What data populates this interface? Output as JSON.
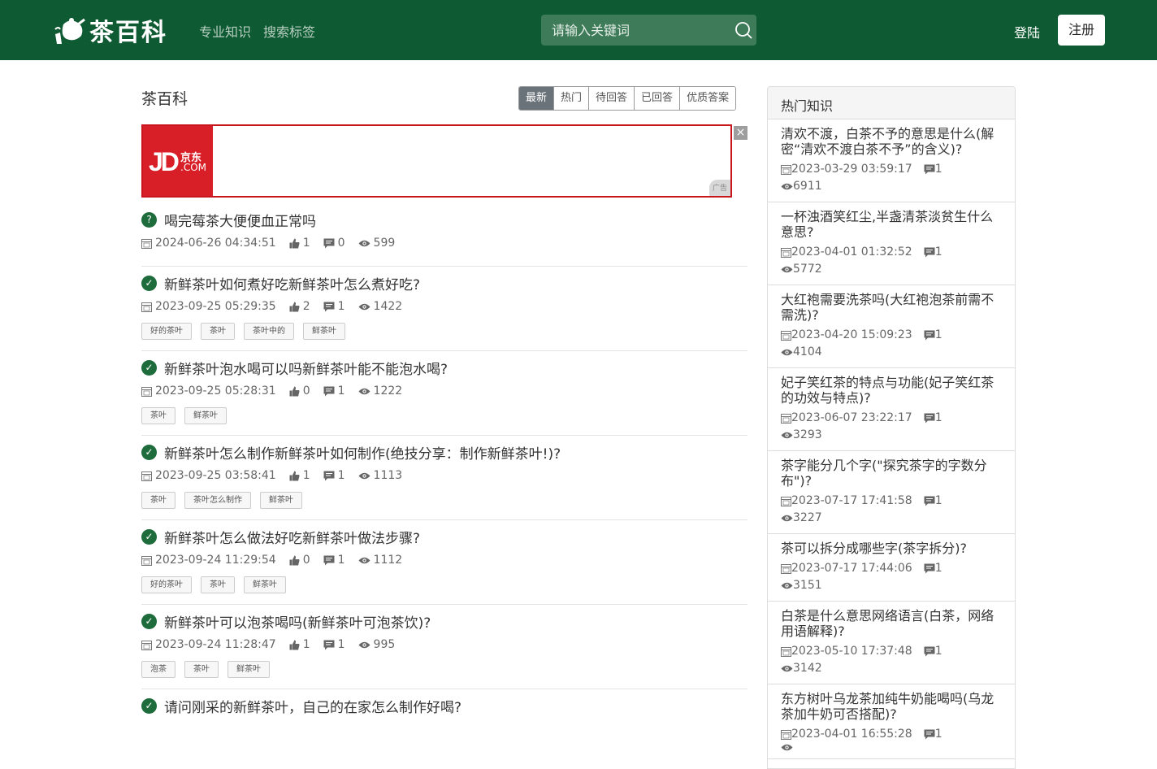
{
  "header": {
    "logo_text": "茶百科",
    "nav": [
      "专业知识",
      "搜索标签"
    ],
    "search_placeholder": "请输入关键词",
    "login": "登陆",
    "register": "注册"
  },
  "main": {
    "title": "茶百科",
    "filters": [
      "最新",
      "热门",
      "待回答",
      "已回答",
      "优质答案"
    ],
    "active_filter": "最新",
    "ad": {
      "brand_short": "JD",
      "brand_cn": "京东",
      "brand_com": ".COM",
      "tag": "广告",
      "close": "×"
    },
    "questions": [
      {
        "title": "喝完莓茶大便便血正常吗",
        "status": "unanswered",
        "status_icon": "?",
        "date": "2024-06-26 04:34:51",
        "likes": "1",
        "comments": "0",
        "views": "599",
        "tags": []
      },
      {
        "title": "新鲜茶叶如何煮好吃新鲜茶叶怎么煮好吃?",
        "status": "answered",
        "status_icon": "✓",
        "date": "2023-09-25 05:29:35",
        "likes": "2",
        "comments": "1",
        "views": "1422",
        "tags": [
          "好的茶叶",
          "茶叶",
          "茶叶中的",
          "鲜茶叶"
        ]
      },
      {
        "title": "新鲜茶叶泡水喝可以吗新鲜茶叶能不能泡水喝?",
        "status": "answered",
        "status_icon": "✓",
        "date": "2023-09-25 05:28:31",
        "likes": "0",
        "comments": "1",
        "views": "1222",
        "tags": [
          "茶叶",
          "鲜茶叶"
        ]
      },
      {
        "title": "新鲜茶叶怎么制作新鲜茶叶如何制作(绝技分享：制作新鲜茶叶!)?",
        "status": "answered",
        "status_icon": "✓",
        "date": "2023-09-25 03:58:41",
        "likes": "1",
        "comments": "1",
        "views": "1113",
        "tags": [
          "茶叶",
          "茶叶怎么制作",
          "鲜茶叶"
        ]
      },
      {
        "title": "新鲜茶叶怎么做法好吃新鲜茶叶做法步骤?",
        "status": "answered",
        "status_icon": "✓",
        "date": "2023-09-24 11:29:54",
        "likes": "0",
        "comments": "1",
        "views": "1112",
        "tags": [
          "好的茶叶",
          "茶叶",
          "鲜茶叶"
        ]
      },
      {
        "title": "新鲜茶叶可以泡茶喝吗(新鲜茶叶可泡茶饮)?",
        "status": "answered",
        "status_icon": "✓",
        "date": "2023-09-24 11:28:47",
        "likes": "1",
        "comments": "1",
        "views": "995",
        "tags": [
          "泡茶",
          "茶叶",
          "鲜茶叶"
        ]
      },
      {
        "title": "请问刚采的新鲜茶叶，自己的在家怎么制作好喝?",
        "status": "answered",
        "status_icon": "✓",
        "date": "",
        "likes": "",
        "comments": "",
        "views": "",
        "tags": []
      }
    ]
  },
  "sidebar": {
    "title": "热门知识",
    "items": [
      {
        "title": "清欢不渡，白茶不予的意思是什么(解密“清欢不渡白茶不予”的含义)?",
        "date": "2023-03-29 03:59:17",
        "comments": "1",
        "views": "6911"
      },
      {
        "title": "一杯浊酒笑红尘,半盏清茶淡贫生什么意思?",
        "date": "2023-04-01 01:32:52",
        "comments": "1",
        "views": "5772"
      },
      {
        "title": "大红袍需要洗茶吗(大红袍泡茶前需不需洗)?",
        "date": "2023-04-20 15:09:23",
        "comments": "1",
        "views": "4104"
      },
      {
        "title": "妃子笑红茶的特点与功能(妃子笑红茶的功效与特点)?",
        "date": "2023-06-07 23:22:17",
        "comments": "1",
        "views": "3293"
      },
      {
        "title": "茶字能分几个字(\"探究茶字的字数分布\")?",
        "date": "2023-07-17 17:41:58",
        "comments": "1",
        "views": "3227"
      },
      {
        "title": "茶可以拆分成哪些字(茶字拆分)?",
        "date": "2023-07-17 17:44:06",
        "comments": "1",
        "views": "3151"
      },
      {
        "title": "白茶是什么意思网络语言(白茶，网络用语解释)?",
        "date": "2023-05-10 17:37:48",
        "comments": "1",
        "views": "3142"
      },
      {
        "title": "东方树叶乌龙茶加纯牛奶能喝吗(乌龙茶加牛奶可否搭配)?",
        "date": "2023-04-01 16:55:28",
        "comments": "1",
        "views": ""
      }
    ]
  },
  "colors": {
    "header_bg": "#0e5a32",
    "accent": "#1e6b3b",
    "ad_red": "#d81e27"
  }
}
